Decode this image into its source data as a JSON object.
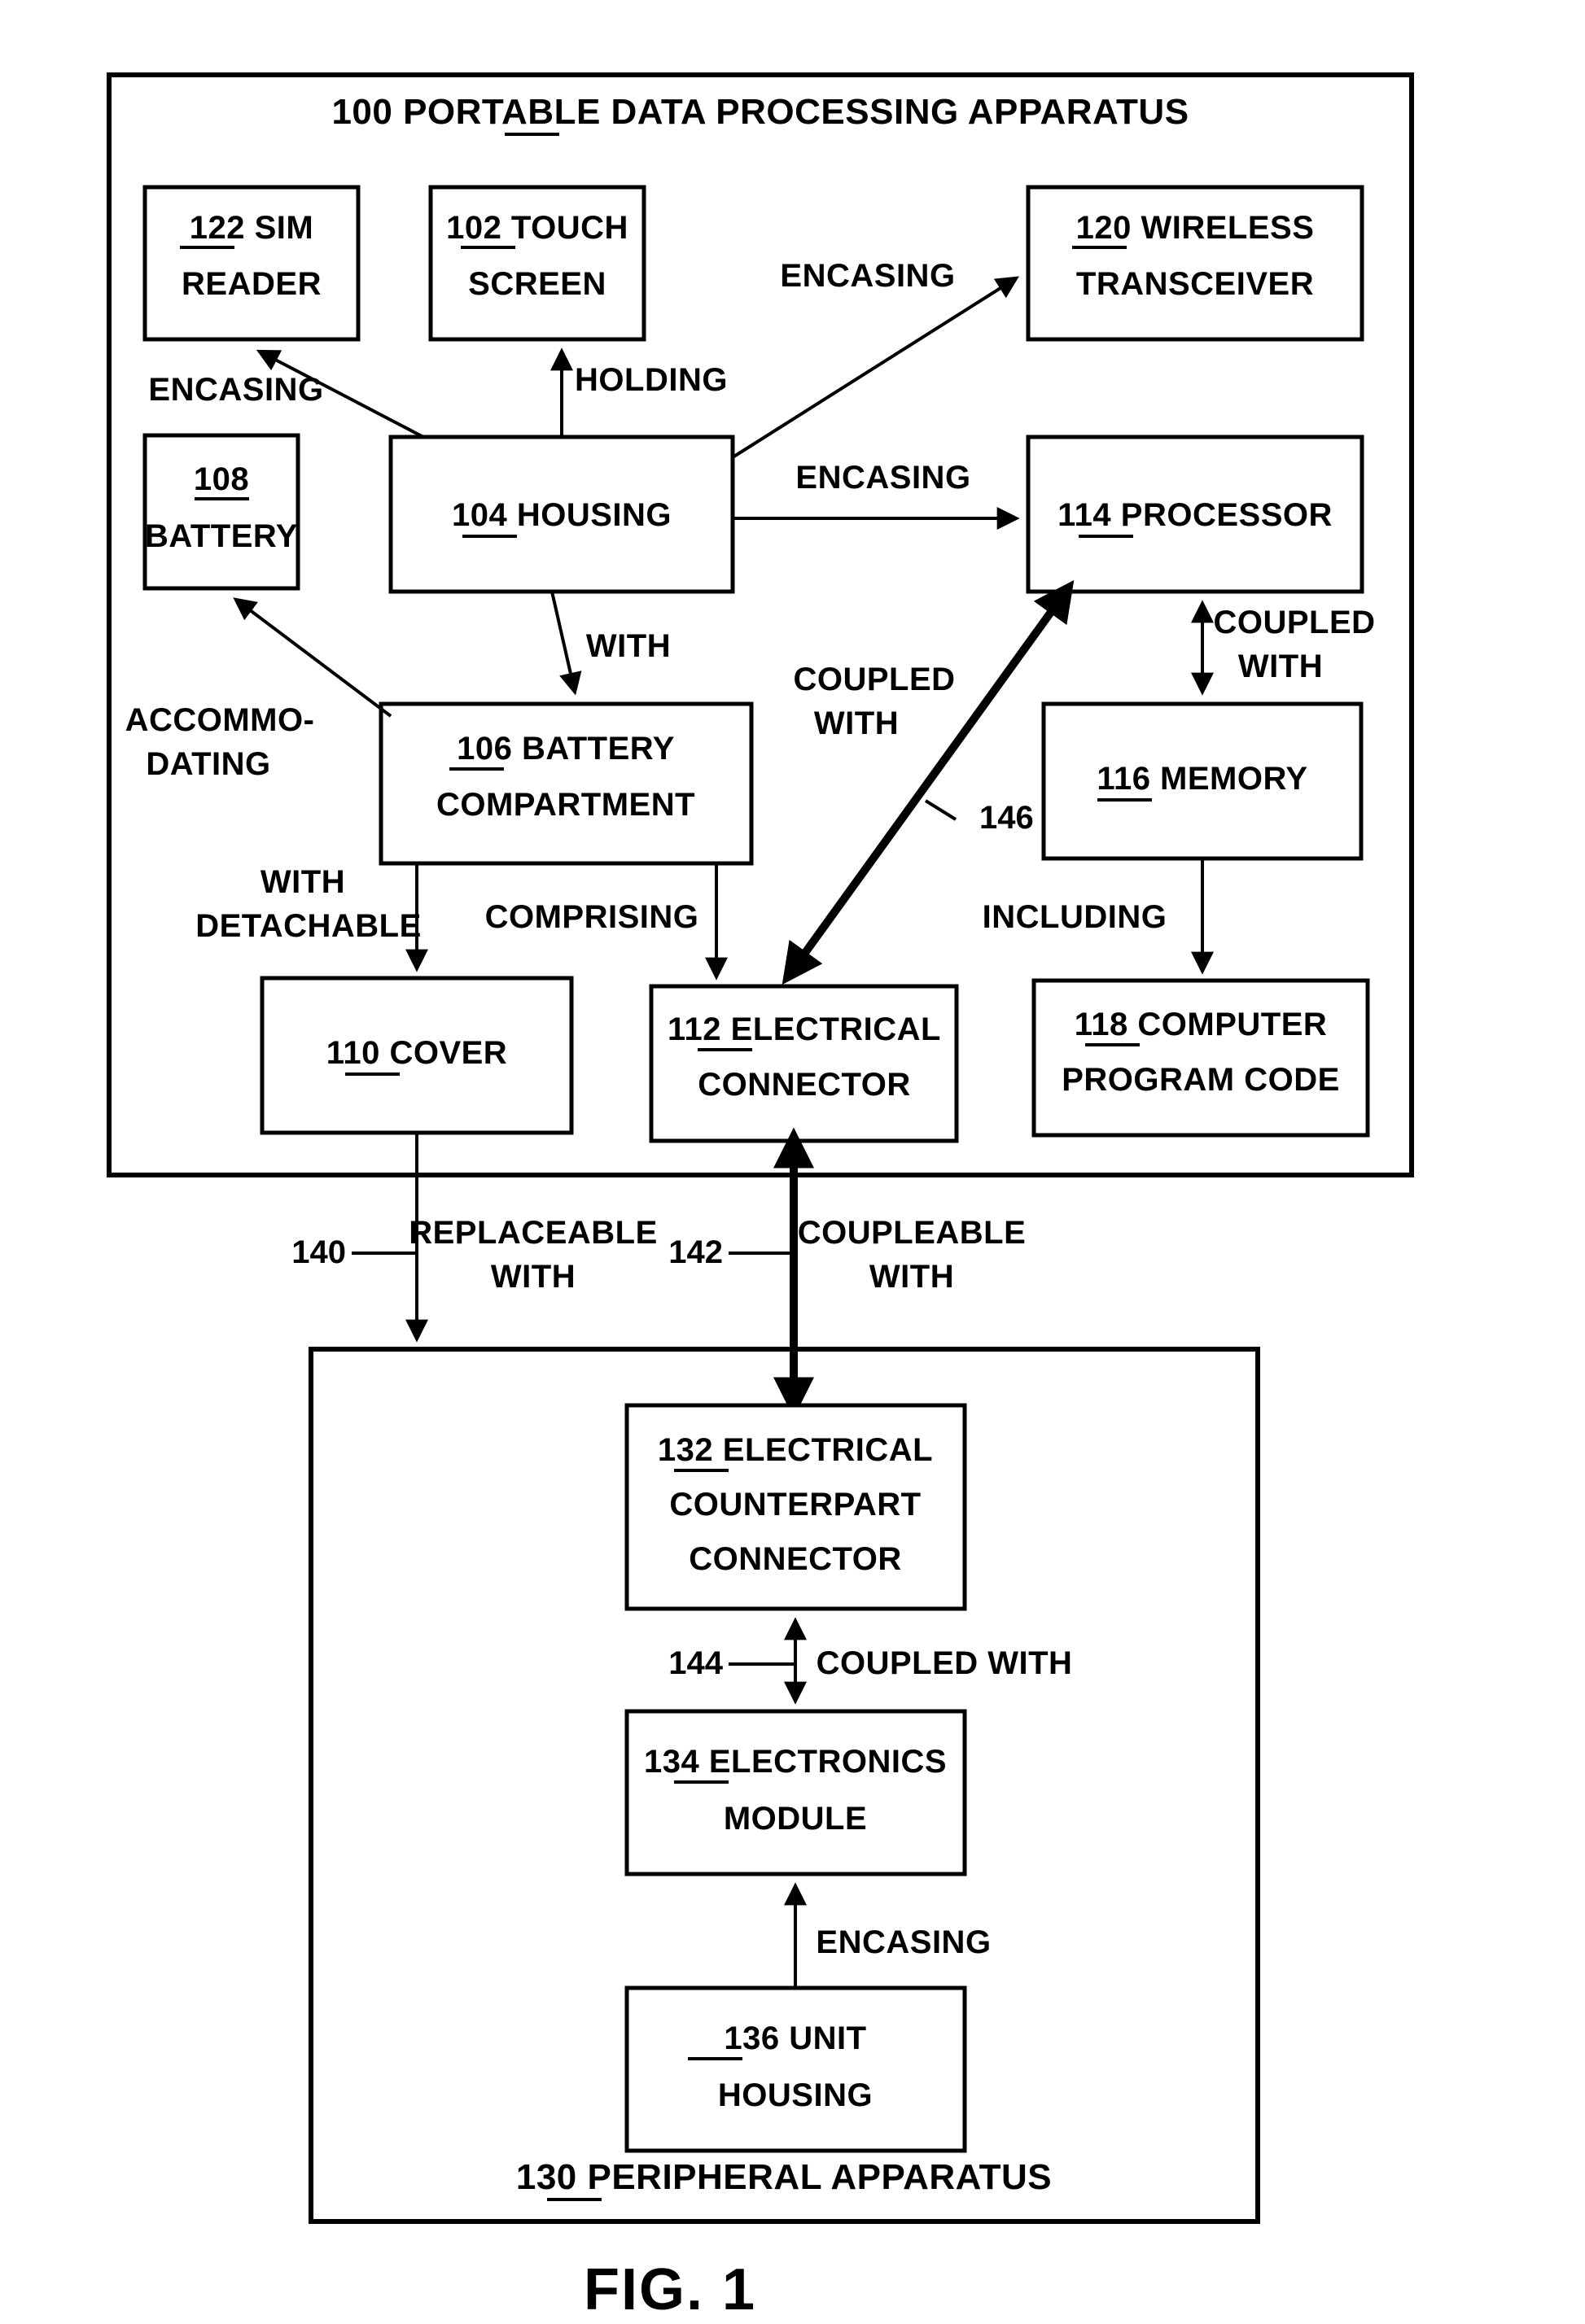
{
  "figure": {
    "caption": "FIG. 1",
    "containers": [
      {
        "id": "100",
        "ref": "100",
        "label": "PORTABLE DATA PROCESSING  APPARATUS",
        "full_label": "100 PORTABLE DATA PROCESSING  APPARATUS"
      },
      {
        "id": "130",
        "ref": "130",
        "label": "PERIPHERAL  APPARATUS",
        "full_label": "130 PERIPHERAL  APPARATUS"
      }
    ],
    "boxes": [
      {
        "id": "122",
        "ref": "122",
        "lines": [
          "SIM",
          "READER"
        ],
        "first_line_text": "122 SIM"
      },
      {
        "id": "102",
        "ref": "102",
        "lines": [
          "TOUCH",
          "SCREEN"
        ],
        "first_line_text": "102 TOUCH"
      },
      {
        "id": "120",
        "ref": "120",
        "lines": [
          "WIRELESS",
          "TRANSCEIVER"
        ],
        "first_line_text": "120 WIRELESS"
      },
      {
        "id": "108",
        "ref": "108",
        "lines": [
          "",
          "BATTERY"
        ],
        "first_line_text": "108"
      },
      {
        "id": "104",
        "ref": "104",
        "lines": [
          "HOUSING"
        ],
        "first_line_text": "104 HOUSING"
      },
      {
        "id": "114",
        "ref": "114",
        "lines": [
          "PROCESSOR"
        ],
        "first_line_text": "114 PROCESSOR"
      },
      {
        "id": "106",
        "ref": "106",
        "lines": [
          "BATTERY",
          "COMPARTMENT"
        ],
        "first_line_text": "106 BATTERY"
      },
      {
        "id": "116",
        "ref": "116",
        "lines": [
          "MEMORY"
        ],
        "first_line_text": "116 MEMORY"
      },
      {
        "id": "110",
        "ref": "110",
        "lines": [
          "COVER"
        ],
        "first_line_text": "110 COVER"
      },
      {
        "id": "112",
        "ref": "112",
        "lines": [
          "ELECTRICAL",
          "CONNECTOR"
        ],
        "first_line_text": "112 ELECTRICAL"
      },
      {
        "id": "118",
        "ref": "118",
        "lines": [
          "COMPUTER",
          "PROGRAM CODE"
        ],
        "first_line_text": "118 COMPUTER"
      },
      {
        "id": "132",
        "ref": "132",
        "lines": [
          "ELECTRICAL",
          "COUNTERPART",
          "CONNECTOR"
        ],
        "first_line_text": "132 ELECTRICAL"
      },
      {
        "id": "134",
        "ref": "134",
        "lines": [
          "ELECTRONICS",
          "MODULE"
        ],
        "first_line_text": "134 ELECTRONICS"
      },
      {
        "id": "136",
        "ref": "136",
        "lines": [
          "UNIT",
          "HOUSING"
        ],
        "first_line_text": "136 UNIT"
      }
    ],
    "edge_labels": [
      {
        "id": "enc-sim",
        "text": "ENCASING",
        "from": "104",
        "to": "122"
      },
      {
        "id": "holding",
        "text": "HOLDING",
        "from": "104",
        "to": "102"
      },
      {
        "id": "enc-wireless",
        "text": "ENCASING",
        "from": "104",
        "to": "120"
      },
      {
        "id": "enc-processor",
        "text": "ENCASING",
        "from": "104",
        "to": "114"
      },
      {
        "id": "with",
        "text": "WITH",
        "from": "104",
        "to": "106"
      },
      {
        "id": "accommodating",
        "text": "ACCOMMO-\nDATING",
        "line1": "ACCOMMO-",
        "line2": "DATING",
        "from": "106",
        "to": "108"
      },
      {
        "id": "coupled-with-146",
        "line1": "COUPLED",
        "line2": "WITH",
        "from": "112",
        "to": "114"
      },
      {
        "id": "coupled-with-mem",
        "line1": "COUPLED",
        "line2": "WITH",
        "from": "114",
        "to": "116"
      },
      {
        "id": "with-detachable",
        "line1": "WITH",
        "line2": "DETACHABLE",
        "from": "106",
        "to": "110"
      },
      {
        "id": "comprising",
        "text": "COMPRISING",
        "from": "106",
        "to": "112"
      },
      {
        "id": "including",
        "text": "INCLUDING",
        "from": "116",
        "to": "118"
      },
      {
        "id": "replaceable-with",
        "line1": "REPLACEABLE",
        "line2": "WITH",
        "from": "110",
        "to": "130"
      },
      {
        "id": "coupleable-with",
        "line1": "COUPLEABLE",
        "line2": "WITH",
        "from": "132",
        "to": "112"
      },
      {
        "id": "coupled-with-144",
        "text": "COUPLED WITH",
        "from": "132",
        "to": "134"
      },
      {
        "id": "encasing-module",
        "text": "ENCASING",
        "from": "136",
        "to": "134"
      }
    ],
    "reference_numerals": [
      {
        "id": "146",
        "value": "146"
      },
      {
        "id": "140",
        "value": "140"
      },
      {
        "id": "142",
        "value": "142"
      },
      {
        "id": "144",
        "value": "144"
      }
    ],
    "colors": {
      "stroke": "#000000",
      "background": "#ffffff"
    }
  }
}
